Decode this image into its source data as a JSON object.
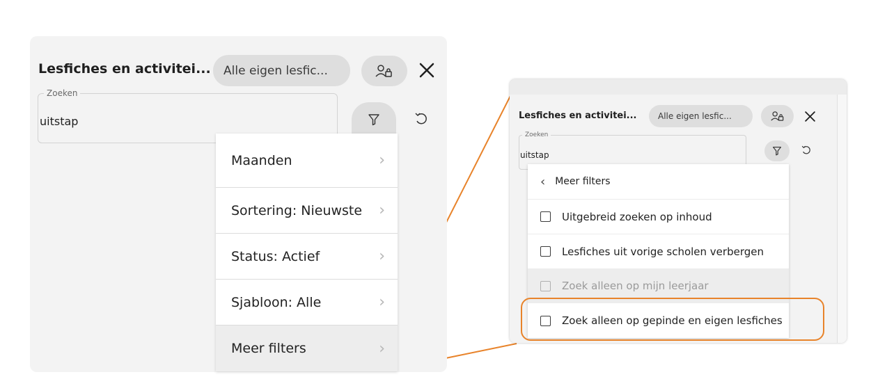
{
  "left_panel": {
    "title": "Lesfiches en activitei...",
    "filter_pill": "Alle eigen lesfic...",
    "search_legend": "Zoeken",
    "search_value": "uitstap",
    "menu_items": [
      "Maanden",
      "Sortering: Nieuwste",
      "Status: Actief",
      "Sjabloon: Alle",
      "Meer filters"
    ]
  },
  "right_panel": {
    "title": "Lesfiches en activitei...",
    "filter_pill": "Alle eigen lesfic...",
    "search_legend": "Zoeken",
    "search_value": "uitstap",
    "submenu_title": "Meer filters",
    "options": [
      {
        "label": "Uitgebreid zoeken op inhoud",
        "checked": false,
        "disabled": false
      },
      {
        "label": "Lesfiches uit vorige scholen verbergen",
        "checked": false,
        "disabled": false
      },
      {
        "label": "Zoek alleen op mijn leerjaar",
        "checked": false,
        "disabled": true
      },
      {
        "label": "Zoek alleen op gepinde en eigen lesfiches",
        "checked": false,
        "disabled": false,
        "highlighted": true
      }
    ]
  },
  "colors": {
    "panel_bg": "#f3f3f3",
    "pill_bg": "#dedede",
    "highlight": "#e8832a",
    "connector": "#e8832a"
  },
  "icons": [
    "user-lock-icon",
    "close-icon",
    "filter-icon",
    "reset-icon",
    "chevron-right-icon",
    "chevron-left-icon",
    "checkbox-icon"
  ]
}
